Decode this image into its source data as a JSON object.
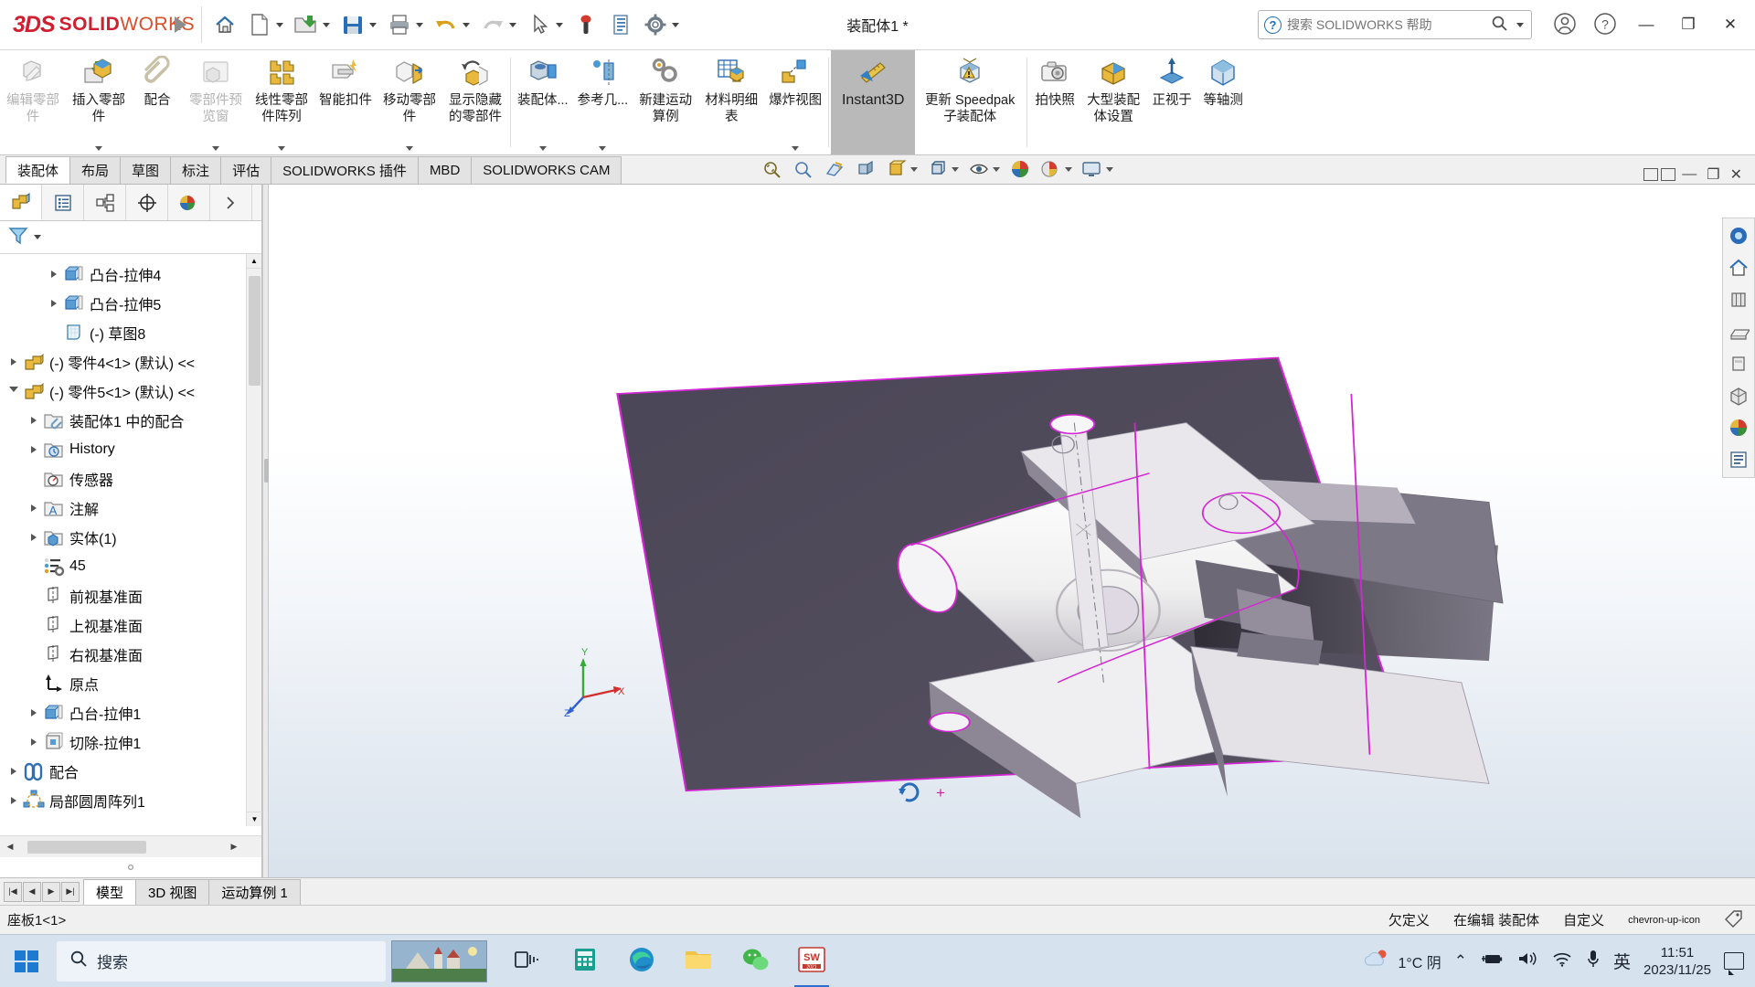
{
  "app": {
    "brand_3ds": "3DS",
    "brand_solid": "SOLID",
    "brand_works": "WORKS",
    "document_title": "装配体1 *"
  },
  "titlebar": {
    "quick_access": [
      {
        "name": "home-icon",
        "label": "主页"
      },
      {
        "name": "new-document-icon",
        "label": "新建"
      },
      {
        "name": "open-folder-icon",
        "label": "打开"
      },
      {
        "name": "save-icon",
        "label": "保存"
      },
      {
        "name": "print-icon",
        "label": "打印"
      },
      {
        "name": "undo-icon",
        "label": "撤消"
      },
      {
        "name": "redo-icon",
        "label": "重做"
      },
      {
        "name": "select-cursor-icon",
        "label": "选择"
      },
      {
        "name": "rebuild-icon",
        "label": "重建模型"
      },
      {
        "name": "file-properties-icon",
        "label": "文件属性"
      },
      {
        "name": "options-gear-icon",
        "label": "选项"
      }
    ],
    "search_placeholder": "搜索 SOLIDWORKS 帮助",
    "account_icon": "user-account-icon",
    "help_icon": "help-question-icon",
    "minimize": "—",
    "maximize": "❐",
    "close": "✕"
  },
  "ribbon": {
    "commands": [
      {
        "label": "编辑零部件",
        "icon": "edit-component-icon",
        "disabled": true,
        "dropdown": false,
        "selected": false,
        "latin": false
      },
      {
        "label": "插入零部件",
        "icon": "insert-component-icon",
        "disabled": false,
        "dropdown": true,
        "selected": false,
        "latin": false
      },
      {
        "label": "配合",
        "icon": "mate-paperclip-icon",
        "disabled": false,
        "dropdown": false,
        "selected": false,
        "latin": false
      },
      {
        "label": "零部件预览窗",
        "icon": "component-preview-icon",
        "disabled": true,
        "dropdown": true,
        "selected": false,
        "latin": false
      },
      {
        "label": "线性零部件阵列",
        "icon": "linear-component-pattern-icon",
        "disabled": false,
        "dropdown": true,
        "selected": false,
        "latin": false
      },
      {
        "label": "智能扣件",
        "icon": "smart-fasteners-icon",
        "disabled": false,
        "dropdown": false,
        "selected": false,
        "latin": false
      },
      {
        "label": "移动零部件",
        "icon": "move-component-icon",
        "disabled": false,
        "dropdown": true,
        "selected": false,
        "latin": false
      },
      {
        "label": "显示隐藏的零部件",
        "icon": "show-hidden-components-icon",
        "disabled": false,
        "dropdown": false,
        "selected": false,
        "latin": false
      },
      {
        "label": "装配体...",
        "icon": "assembly-features-icon",
        "disabled": false,
        "dropdown": true,
        "selected": false,
        "latin": false
      },
      {
        "label": "参考几...",
        "icon": "reference-geometry-icon",
        "disabled": false,
        "dropdown": true,
        "selected": false,
        "latin": false
      },
      {
        "label": "新建运动算例",
        "icon": "new-motion-study-icon",
        "disabled": false,
        "dropdown": false,
        "selected": false,
        "latin": false
      },
      {
        "label": "材料明细表",
        "icon": "bill-of-materials-icon",
        "disabled": false,
        "dropdown": false,
        "selected": false,
        "latin": false
      },
      {
        "label": "爆炸视图",
        "icon": "exploded-view-icon",
        "disabled": false,
        "dropdown": true,
        "selected": false,
        "latin": false
      },
      {
        "label": "Instant3D",
        "icon": "instant3d-icon",
        "disabled": false,
        "dropdown": false,
        "selected": true,
        "latin": true
      },
      {
        "label": "更新 Speedpak 子装配体",
        "icon": "update-speedpak-icon",
        "disabled": false,
        "dropdown": false,
        "selected": false,
        "latin": false
      },
      {
        "label": "拍快照",
        "icon": "take-snapshot-camera-icon",
        "disabled": false,
        "dropdown": false,
        "selected": false,
        "latin": false
      },
      {
        "label": "大型装配体设置",
        "icon": "large-assembly-settings-icon",
        "disabled": false,
        "dropdown": false,
        "selected": false,
        "latin": false
      },
      {
        "label": "正视于",
        "icon": "normal-to-icon",
        "disabled": false,
        "dropdown": false,
        "selected": false,
        "latin": false
      },
      {
        "label": "等轴测",
        "icon": "isometric-view-icon",
        "disabled": false,
        "dropdown": false,
        "selected": false,
        "latin": false
      }
    ]
  },
  "tabstrip": {
    "tabs": [
      {
        "label": "装配体",
        "active": true
      },
      {
        "label": "布局",
        "active": false
      },
      {
        "label": "草图",
        "active": false
      },
      {
        "label": "标注",
        "active": false
      },
      {
        "label": "评估",
        "active": false
      },
      {
        "label": "SOLIDWORKS 插件",
        "active": false
      },
      {
        "label": "MBD",
        "active": false
      },
      {
        "label": "SOLIDWORKS CAM",
        "active": false
      }
    ],
    "view_tools": [
      {
        "name": "zoom-to-fit-icon"
      },
      {
        "name": "zoom-area-icon"
      },
      {
        "name": "previous-view-icon"
      },
      {
        "name": "section-view-icon"
      },
      {
        "name": "view-orientation-icon"
      },
      {
        "name": "display-style-icon"
      },
      {
        "name": "hide-show-items-icon"
      },
      {
        "name": "edit-appearance-icon"
      },
      {
        "name": "apply-scene-icon"
      },
      {
        "name": "view-settings-icon"
      }
    ],
    "window_controls": [
      "restore-down-icon",
      "restore-icon",
      "minimize-icon",
      "maximize-icon",
      "close-icon"
    ]
  },
  "feature_manager": {
    "panel_tabs": [
      {
        "name": "feature-tree-tab",
        "active": true
      },
      {
        "name": "property-manager-tab",
        "active": false
      },
      {
        "name": "configuration-manager-tab",
        "active": false
      },
      {
        "name": "dimxpert-manager-tab",
        "active": false
      },
      {
        "name": "display-manager-tab",
        "active": false
      },
      {
        "name": "expand-panel-tab",
        "active": false
      }
    ],
    "filter_icon": "filter-funnel-icon",
    "tree": [
      {
        "label": "凸台-拉伸4",
        "icon": "boss-extrude-icon",
        "indent": 2,
        "arrow": "collapsed"
      },
      {
        "label": "凸台-拉伸5",
        "icon": "boss-extrude-icon",
        "indent": 2,
        "arrow": "collapsed"
      },
      {
        "label": "(-) 草图8",
        "icon": "sketch-icon",
        "indent": 2,
        "arrow": "none"
      },
      {
        "label": "(-) 零件4<1> (默认) <<",
        "icon": "part-icon",
        "indent": 0,
        "arrow": "collapsed"
      },
      {
        "label": "(-) 零件5<1> (默认) <<",
        "icon": "part-icon",
        "indent": 0,
        "arrow": "expanded"
      },
      {
        "label": "装配体1 中的配合",
        "icon": "mates-folder-icon",
        "indent": 1,
        "arrow": "collapsed"
      },
      {
        "label": "History",
        "icon": "history-folder-icon",
        "indent": 1,
        "arrow": "collapsed"
      },
      {
        "label": "传感器",
        "icon": "sensors-icon",
        "indent": 1,
        "arrow": "none"
      },
      {
        "label": "注解",
        "icon": "annotations-icon",
        "indent": 1,
        "arrow": "collapsed"
      },
      {
        "label": "实体(1)",
        "icon": "solid-bodies-icon",
        "indent": 1,
        "arrow": "collapsed"
      },
      {
        "label": "45",
        "icon": "material-icon",
        "indent": 1,
        "arrow": "none"
      },
      {
        "label": "前视基准面",
        "icon": "plane-icon",
        "indent": 1,
        "arrow": "none"
      },
      {
        "label": "上视基准面",
        "icon": "plane-icon",
        "indent": 1,
        "arrow": "none"
      },
      {
        "label": "右视基准面",
        "icon": "plane-icon",
        "indent": 1,
        "arrow": "none"
      },
      {
        "label": "原点",
        "icon": "origin-icon",
        "indent": 1,
        "arrow": "none"
      },
      {
        "label": "凸台-拉伸1",
        "icon": "boss-extrude-icon",
        "indent": 1,
        "arrow": "collapsed"
      },
      {
        "label": "切除-拉伸1",
        "icon": "cut-extrude-icon",
        "indent": 1,
        "arrow": "collapsed"
      },
      {
        "label": "配合",
        "icon": "mates-icon",
        "indent": 0,
        "arrow": "collapsed"
      },
      {
        "label": "局部圆周阵列1",
        "icon": "circular-pattern-icon",
        "indent": 0,
        "arrow": "collapsed"
      }
    ]
  },
  "graphics": {
    "triad_labels": {
      "x": "X",
      "y": "Y",
      "z": "Z"
    },
    "rotate_indicator_icon": "rotate-view-icon",
    "origin_marker": "+",
    "right_toolbar": [
      {
        "name": "view-selector-icon"
      },
      {
        "name": "home-view-icon"
      },
      {
        "name": "front-view-icon"
      },
      {
        "name": "top-view-icon"
      },
      {
        "name": "right-view-icon"
      },
      {
        "name": "isometric-view-icon"
      },
      {
        "name": "appearance-sphere-icon"
      },
      {
        "name": "display-manager-icon"
      }
    ]
  },
  "document_tabs": {
    "nav_buttons": [
      "first-tab-icon",
      "previous-tab-icon",
      "next-tab-icon",
      "last-tab-icon"
    ],
    "tabs": [
      {
        "label": "模型",
        "active": true
      },
      {
        "label": "3D 视图",
        "active": false
      },
      {
        "label": "运动算例 1",
        "active": false
      }
    ]
  },
  "status_bar": {
    "left": "座板1<1>",
    "state": "欠定义",
    "mode": "在编辑 装配体",
    "custom": "自定义",
    "expand_icon": "chevron-up-icon",
    "tag_icon": "tag-icon"
  },
  "taskbar": {
    "start_icon": "windows-start-icon",
    "search_icon": "search-icon",
    "search_text": "搜索",
    "buttons": [
      {
        "name": "task-view-icon"
      },
      {
        "name": "calculator-icon"
      },
      {
        "name": "microsoft-edge-icon"
      },
      {
        "name": "file-explorer-icon"
      },
      {
        "name": "wechat-icon"
      },
      {
        "name": "solidworks-taskbar-icon",
        "active": true
      }
    ],
    "tray": {
      "weather_icon": "cloud-weather-icon",
      "weather": "1°C 阴",
      "chevron": "⌃",
      "icons": [
        "battery-charging-icon",
        "volume-icon",
        "wifi-icon",
        "microphone-icon"
      ],
      "ime": "英",
      "time": "11:51",
      "date": "2023/11/25",
      "notification_icon": "notification-icon"
    }
  },
  "colors": {
    "brand_red": "#cf2030",
    "accent_blue": "#2b6cb8",
    "selection_magenta": "#e000e0",
    "ribbon_selected": "#b9b9b9",
    "taskbar_bg": "#d7e2ef"
  }
}
